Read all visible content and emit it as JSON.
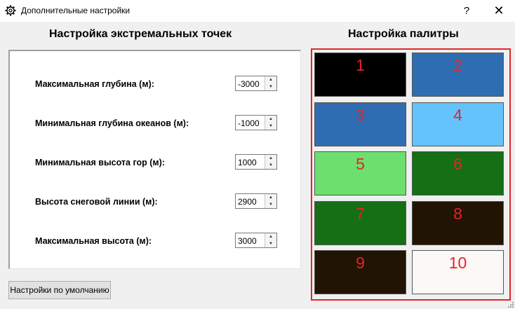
{
  "window": {
    "title": "Дополнительные настройки",
    "help_label": "?",
    "close_label": "✕",
    "title_icon": "gear-icon"
  },
  "left": {
    "title": "Настройка экстремальных точек",
    "fields": [
      {
        "label": "Максимальная глубина (м):",
        "value": "-3000"
      },
      {
        "label": "Минимальная глубина океанов (м):",
        "value": "-1000"
      },
      {
        "label": "Минимальная высота гор (м):",
        "value": "1000"
      },
      {
        "label": "Высота снеговой линии (м):",
        "value": "2900"
      },
      {
        "label": "Максимальная высота (м):",
        "value": "3000"
      }
    ],
    "default_button": "Настройки по умолчанию"
  },
  "palette": {
    "title": "Настройка палитры",
    "frame_color": "#e32429",
    "swatches": [
      {
        "number": "1",
        "color": "#000000"
      },
      {
        "number": "2",
        "color": "#2e6db2"
      },
      {
        "number": "3",
        "color": "#2e6db2"
      },
      {
        "number": "4",
        "color": "#64c3fd"
      },
      {
        "number": "5",
        "color": "#6ddf6f"
      },
      {
        "number": "6",
        "color": "#146f15"
      },
      {
        "number": "7",
        "color": "#146f15"
      },
      {
        "number": "8",
        "color": "#211402"
      },
      {
        "number": "9",
        "color": "#211402"
      },
      {
        "number": "10",
        "color": "#fdf8f8"
      }
    ]
  }
}
